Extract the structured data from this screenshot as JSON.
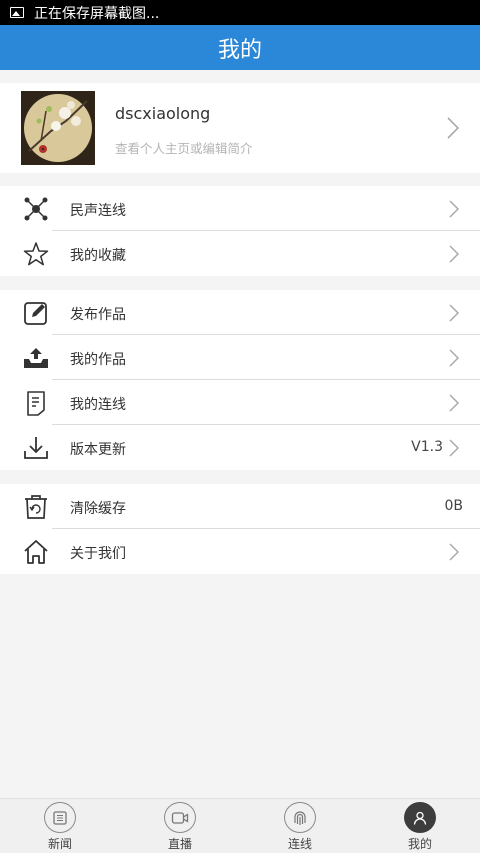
{
  "status_bar": {
    "text": "正在保存屏幕截图..."
  },
  "header": {
    "title": "我的"
  },
  "profile": {
    "username": "dscxiaolong",
    "subtitle": "查看个人主页或编辑简介"
  },
  "group1": [
    {
      "label": "民声连线",
      "icon": "network-icon"
    },
    {
      "label": "我的收藏",
      "icon": "star-icon"
    }
  ],
  "group2": [
    {
      "label": "发布作品",
      "icon": "edit-icon"
    },
    {
      "label": "我的作品",
      "icon": "upload-tray-icon"
    },
    {
      "label": "我的连线",
      "icon": "document-icon"
    },
    {
      "label": "版本更新",
      "icon": "download-icon",
      "value": "V1.3"
    }
  ],
  "group3": [
    {
      "label": "清除缓存",
      "icon": "trash-refresh-icon",
      "value": "0B"
    },
    {
      "label": "关于我们",
      "icon": "home-icon"
    }
  ],
  "tabbar": [
    {
      "label": "新闻",
      "icon": "news-icon"
    },
    {
      "label": "直播",
      "icon": "live-camera-icon"
    },
    {
      "label": "连线",
      "icon": "fingerprint-icon"
    },
    {
      "label": "我的",
      "icon": "user-icon",
      "active": true
    }
  ]
}
